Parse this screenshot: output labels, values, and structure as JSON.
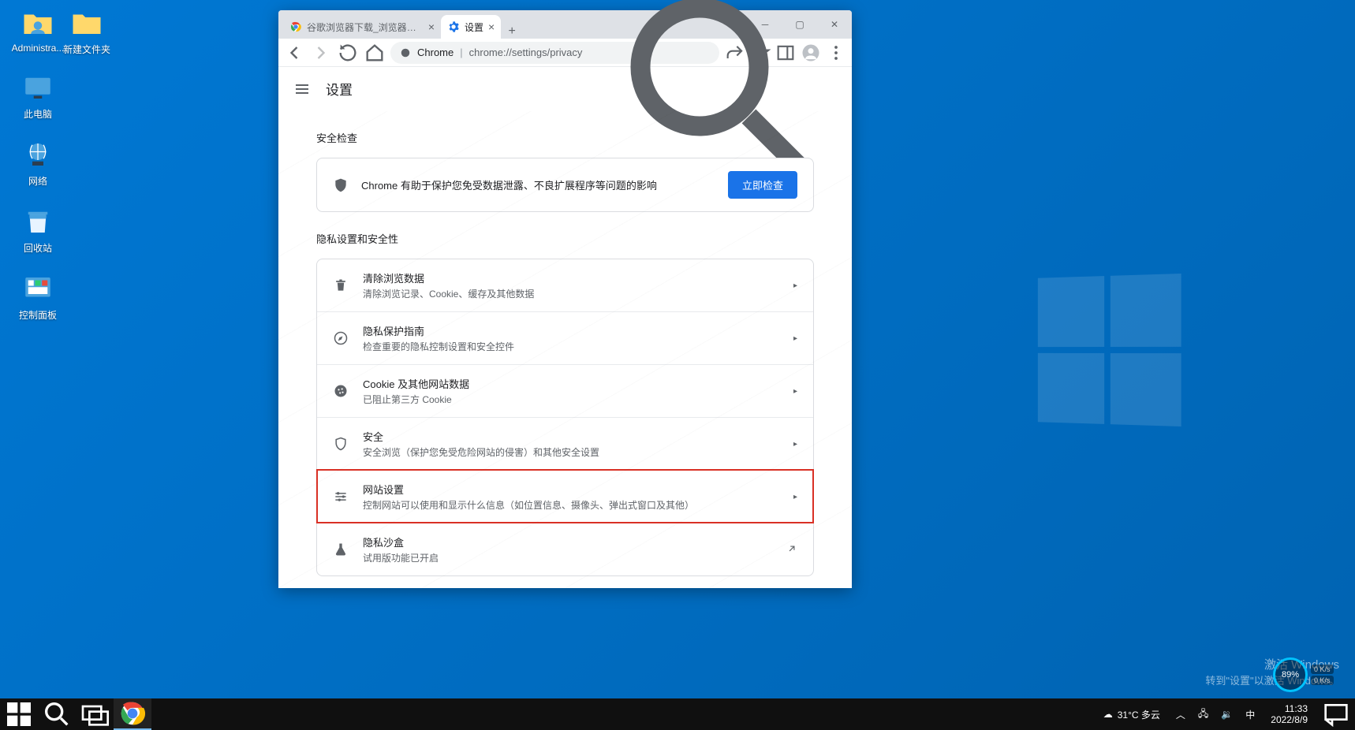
{
  "desktop": {
    "icons": [
      {
        "label": "Administra...",
        "name": "user-folder-icon"
      },
      {
        "label": "新建文件夹",
        "name": "folder-icon"
      },
      {
        "label": "此电脑",
        "name": "this-pc-icon"
      },
      {
        "label": "网络",
        "name": "network-icon"
      },
      {
        "label": "回收站",
        "name": "recycle-bin-icon"
      },
      {
        "label": "控制面板",
        "name": "control-panel-icon"
      }
    ]
  },
  "chrome": {
    "tabs": [
      {
        "title": "谷歌浏览器下载_浏览器官网入口",
        "active": false
      },
      {
        "title": "设置",
        "active": true
      }
    ],
    "address": {
      "chip": "Chrome",
      "path": "chrome://settings/privacy"
    },
    "settings": {
      "title": "设置",
      "section_safety": "安全检查",
      "safety_desc": "Chrome 有助于保护您免受数据泄露、不良扩展程序等问题的影响",
      "safety_button": "立即检查",
      "section_privacy": "隐私设置和安全性",
      "rows": [
        {
          "icon": "trash-icon",
          "title": "清除浏览数据",
          "sub": "清除浏览记录、Cookie、缓存及其他数据",
          "arrow": "▶",
          "hl": false
        },
        {
          "icon": "compass-icon",
          "title": "隐私保护指南",
          "sub": "检查重要的隐私控制设置和安全控件",
          "arrow": "▶",
          "hl": false
        },
        {
          "icon": "cookie-icon",
          "title": "Cookie 及其他网站数据",
          "sub": "已阻止第三方 Cookie",
          "arrow": "▶",
          "hl": false
        },
        {
          "icon": "shield-outline-icon",
          "title": "安全",
          "sub": "安全浏览（保护您免受危险网站的侵害）和其他安全设置",
          "arrow": "▶",
          "hl": false
        },
        {
          "icon": "sliders-icon",
          "title": "网站设置",
          "sub": "控制网站可以使用和显示什么信息（如位置信息、摄像头、弹出式窗口及其他）",
          "arrow": "▶",
          "hl": true
        },
        {
          "icon": "flask-icon",
          "title": "隐私沙盒",
          "sub": "试用版功能已开启",
          "arrow": "⬈",
          "hl": false
        }
      ]
    }
  },
  "activation": {
    "line1": "激活 Windows",
    "line2": "转到\"设置\"以激活 Windows。"
  },
  "netwidget": {
    "cpu": "89%",
    "up": "0 K/s",
    "down": "0 K/s"
  },
  "taskbar": {
    "weather_text": "31°C 多云",
    "ime": "中",
    "time": "11:33",
    "date": "2022/8/9"
  }
}
